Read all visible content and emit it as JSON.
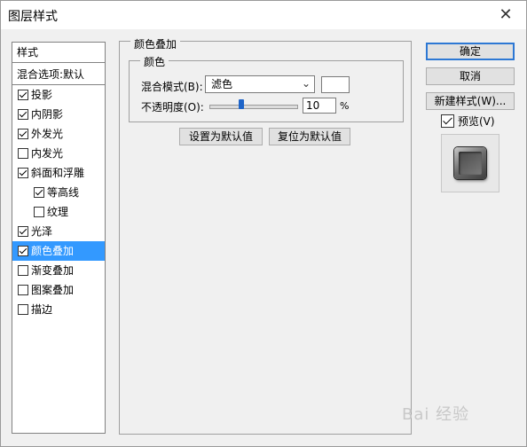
{
  "window": {
    "title": "图层样式",
    "close": "✕"
  },
  "left_panel": {
    "header": "样式",
    "blend_options": "混合选项:默认",
    "items": [
      {
        "label": "投影",
        "checked": true
      },
      {
        "label": "内阴影",
        "checked": true
      },
      {
        "label": "外发光",
        "checked": true
      },
      {
        "label": "内发光",
        "checked": false
      },
      {
        "label": "斜面和浮雕",
        "checked": true
      },
      {
        "label": "等高线",
        "checked": true
      },
      {
        "label": "纹理",
        "checked": false
      },
      {
        "label": "光泽",
        "checked": true
      },
      {
        "label": "颜色叠加",
        "checked": true,
        "selected": true
      },
      {
        "label": "渐变叠加",
        "checked": false
      },
      {
        "label": "图案叠加",
        "checked": false
      },
      {
        "label": "描边",
        "checked": false
      }
    ]
  },
  "color_overlay": {
    "section_title": "颜色叠加",
    "group_title": "颜色",
    "blend_mode_label": "混合模式(B):",
    "blend_mode_value": "滤色",
    "overlay_color": "#ffffff",
    "opacity_label": "不透明度(O):",
    "opacity_value": "10",
    "opacity_unit": "%",
    "set_default": "设置为默认值",
    "reset_default": "复位为默认值"
  },
  "actions": {
    "ok": "确定",
    "cancel": "取消",
    "new_style": "新建样式(W)...",
    "preview_label": "预览(V)",
    "preview_checked": true
  },
  "watermark": "Bai 经验"
}
